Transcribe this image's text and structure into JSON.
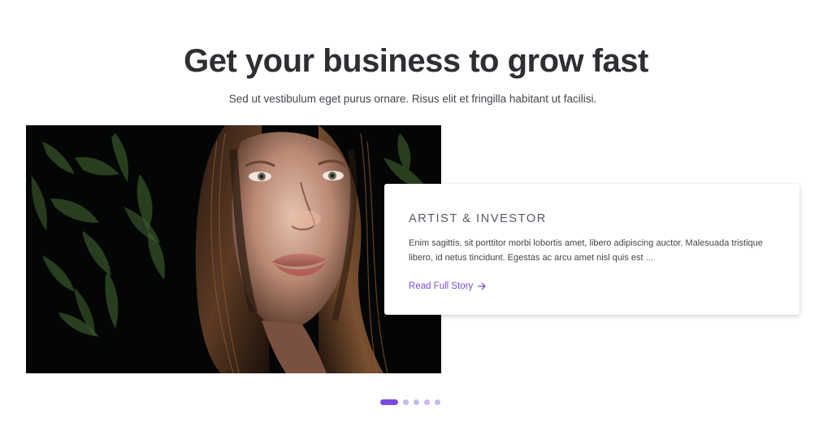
{
  "hero": {
    "headline": "Get your business to grow fast",
    "subheadline": "Sed ut vestibulum eget purus ornare. Risus elit et fringilla habitant ut facilisi."
  },
  "story_card": {
    "title": "ARTIST & INVESTOR",
    "body": "Enim sagittis, sit porttitor morbi lobortis amet, libero adipiscing auctor. Malesuada tristique libero, id netus tincidunt. Egestas ac arcu amet nisl quis est ...",
    "link_label": "Read Full Story",
    "link_icon": "arrow-right-icon"
  },
  "carousel": {
    "total_slides": 5,
    "active_index": 0
  },
  "colors": {
    "accent": "#7b4ae0",
    "dot_inactive": "#c9b8f2",
    "heading": "#2e2e33",
    "body_text": "#45454d"
  }
}
